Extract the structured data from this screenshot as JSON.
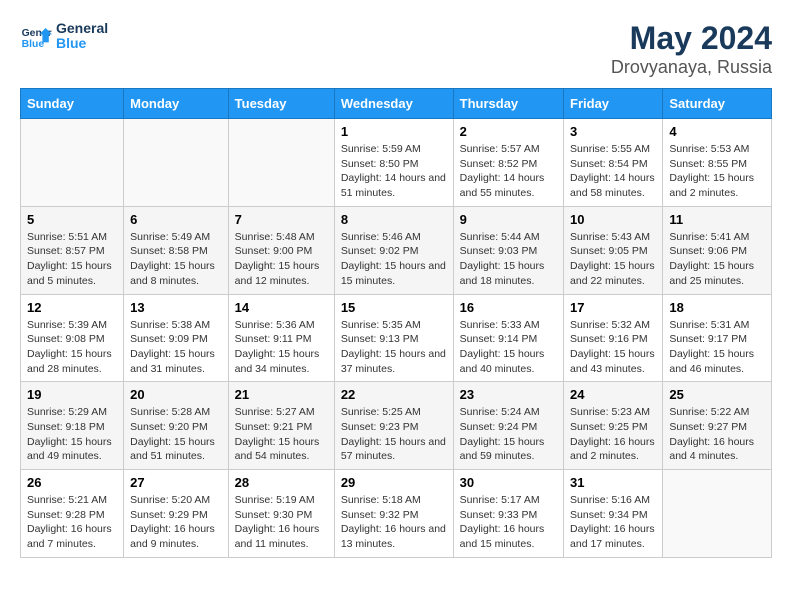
{
  "logo": {
    "text_general": "General",
    "text_blue": "Blue"
  },
  "title": "May 2024",
  "subtitle": "Drovyanaya, Russia",
  "days_of_week": [
    "Sunday",
    "Monday",
    "Tuesday",
    "Wednesday",
    "Thursday",
    "Friday",
    "Saturday"
  ],
  "weeks": [
    [
      {
        "day": "",
        "sunrise": "",
        "sunset": "",
        "daylight": ""
      },
      {
        "day": "",
        "sunrise": "",
        "sunset": "",
        "daylight": ""
      },
      {
        "day": "",
        "sunrise": "",
        "sunset": "",
        "daylight": ""
      },
      {
        "day": "1",
        "sunrise": "Sunrise: 5:59 AM",
        "sunset": "Sunset: 8:50 PM",
        "daylight": "Daylight: 14 hours and 51 minutes."
      },
      {
        "day": "2",
        "sunrise": "Sunrise: 5:57 AM",
        "sunset": "Sunset: 8:52 PM",
        "daylight": "Daylight: 14 hours and 55 minutes."
      },
      {
        "day": "3",
        "sunrise": "Sunrise: 5:55 AM",
        "sunset": "Sunset: 8:54 PM",
        "daylight": "Daylight: 14 hours and 58 minutes."
      },
      {
        "day": "4",
        "sunrise": "Sunrise: 5:53 AM",
        "sunset": "Sunset: 8:55 PM",
        "daylight": "Daylight: 15 hours and 2 minutes."
      }
    ],
    [
      {
        "day": "5",
        "sunrise": "Sunrise: 5:51 AM",
        "sunset": "Sunset: 8:57 PM",
        "daylight": "Daylight: 15 hours and 5 minutes."
      },
      {
        "day": "6",
        "sunrise": "Sunrise: 5:49 AM",
        "sunset": "Sunset: 8:58 PM",
        "daylight": "Daylight: 15 hours and 8 minutes."
      },
      {
        "day": "7",
        "sunrise": "Sunrise: 5:48 AM",
        "sunset": "Sunset: 9:00 PM",
        "daylight": "Daylight: 15 hours and 12 minutes."
      },
      {
        "day": "8",
        "sunrise": "Sunrise: 5:46 AM",
        "sunset": "Sunset: 9:02 PM",
        "daylight": "Daylight: 15 hours and 15 minutes."
      },
      {
        "day": "9",
        "sunrise": "Sunrise: 5:44 AM",
        "sunset": "Sunset: 9:03 PM",
        "daylight": "Daylight: 15 hours and 18 minutes."
      },
      {
        "day": "10",
        "sunrise": "Sunrise: 5:43 AM",
        "sunset": "Sunset: 9:05 PM",
        "daylight": "Daylight: 15 hours and 22 minutes."
      },
      {
        "day": "11",
        "sunrise": "Sunrise: 5:41 AM",
        "sunset": "Sunset: 9:06 PM",
        "daylight": "Daylight: 15 hours and 25 minutes."
      }
    ],
    [
      {
        "day": "12",
        "sunrise": "Sunrise: 5:39 AM",
        "sunset": "Sunset: 9:08 PM",
        "daylight": "Daylight: 15 hours and 28 minutes."
      },
      {
        "day": "13",
        "sunrise": "Sunrise: 5:38 AM",
        "sunset": "Sunset: 9:09 PM",
        "daylight": "Daylight: 15 hours and 31 minutes."
      },
      {
        "day": "14",
        "sunrise": "Sunrise: 5:36 AM",
        "sunset": "Sunset: 9:11 PM",
        "daylight": "Daylight: 15 hours and 34 minutes."
      },
      {
        "day": "15",
        "sunrise": "Sunrise: 5:35 AM",
        "sunset": "Sunset: 9:13 PM",
        "daylight": "Daylight: 15 hours and 37 minutes."
      },
      {
        "day": "16",
        "sunrise": "Sunrise: 5:33 AM",
        "sunset": "Sunset: 9:14 PM",
        "daylight": "Daylight: 15 hours and 40 minutes."
      },
      {
        "day": "17",
        "sunrise": "Sunrise: 5:32 AM",
        "sunset": "Sunset: 9:16 PM",
        "daylight": "Daylight: 15 hours and 43 minutes."
      },
      {
        "day": "18",
        "sunrise": "Sunrise: 5:31 AM",
        "sunset": "Sunset: 9:17 PM",
        "daylight": "Daylight: 15 hours and 46 minutes."
      }
    ],
    [
      {
        "day": "19",
        "sunrise": "Sunrise: 5:29 AM",
        "sunset": "Sunset: 9:18 PM",
        "daylight": "Daylight: 15 hours and 49 minutes."
      },
      {
        "day": "20",
        "sunrise": "Sunrise: 5:28 AM",
        "sunset": "Sunset: 9:20 PM",
        "daylight": "Daylight: 15 hours and 51 minutes."
      },
      {
        "day": "21",
        "sunrise": "Sunrise: 5:27 AM",
        "sunset": "Sunset: 9:21 PM",
        "daylight": "Daylight: 15 hours and 54 minutes."
      },
      {
        "day": "22",
        "sunrise": "Sunrise: 5:25 AM",
        "sunset": "Sunset: 9:23 PM",
        "daylight": "Daylight: 15 hours and 57 minutes."
      },
      {
        "day": "23",
        "sunrise": "Sunrise: 5:24 AM",
        "sunset": "Sunset: 9:24 PM",
        "daylight": "Daylight: 15 hours and 59 minutes."
      },
      {
        "day": "24",
        "sunrise": "Sunrise: 5:23 AM",
        "sunset": "Sunset: 9:25 PM",
        "daylight": "Daylight: 16 hours and 2 minutes."
      },
      {
        "day": "25",
        "sunrise": "Sunrise: 5:22 AM",
        "sunset": "Sunset: 9:27 PM",
        "daylight": "Daylight: 16 hours and 4 minutes."
      }
    ],
    [
      {
        "day": "26",
        "sunrise": "Sunrise: 5:21 AM",
        "sunset": "Sunset: 9:28 PM",
        "daylight": "Daylight: 16 hours and 7 minutes."
      },
      {
        "day": "27",
        "sunrise": "Sunrise: 5:20 AM",
        "sunset": "Sunset: 9:29 PM",
        "daylight": "Daylight: 16 hours and 9 minutes."
      },
      {
        "day": "28",
        "sunrise": "Sunrise: 5:19 AM",
        "sunset": "Sunset: 9:30 PM",
        "daylight": "Daylight: 16 hours and 11 minutes."
      },
      {
        "day": "29",
        "sunrise": "Sunrise: 5:18 AM",
        "sunset": "Sunset: 9:32 PM",
        "daylight": "Daylight: 16 hours and 13 minutes."
      },
      {
        "day": "30",
        "sunrise": "Sunrise: 5:17 AM",
        "sunset": "Sunset: 9:33 PM",
        "daylight": "Daylight: 16 hours and 15 minutes."
      },
      {
        "day": "31",
        "sunrise": "Sunrise: 5:16 AM",
        "sunset": "Sunset: 9:34 PM",
        "daylight": "Daylight: 16 hours and 17 minutes."
      },
      {
        "day": "",
        "sunrise": "",
        "sunset": "",
        "daylight": ""
      }
    ]
  ]
}
